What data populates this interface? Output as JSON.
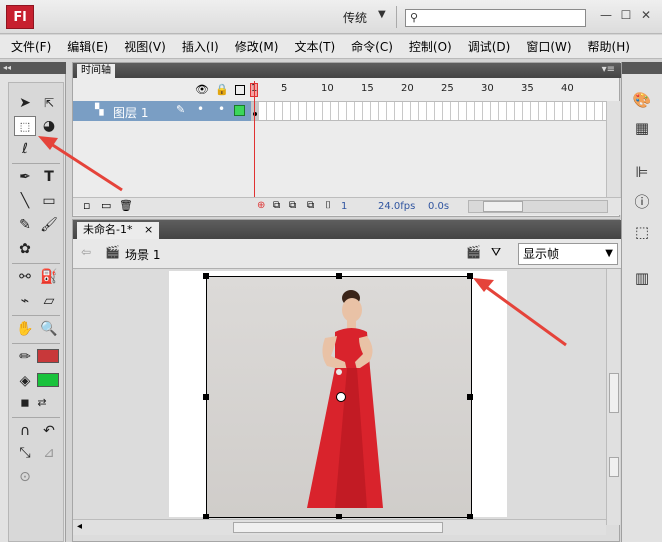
{
  "app": {
    "logo": "Fl",
    "workspace": "传统",
    "window_controls": [
      "—",
      "☐",
      "✕"
    ]
  },
  "menu": [
    "文件(F)",
    "编辑(E)",
    "视图(V)",
    "插入(I)",
    "修改(M)",
    "文本(T)",
    "命令(C)",
    "控制(O)",
    "调试(D)",
    "窗口(W)",
    "帮助(H)"
  ],
  "timeline": {
    "tab": "时间轴",
    "frame_numbers": [
      "1",
      "5",
      "10",
      "15",
      "20",
      "25",
      "30",
      "35",
      "40"
    ],
    "layer": "图层 1",
    "current_frame": "1",
    "fps": "24.0fps",
    "time": "0.0s"
  },
  "document": {
    "tab": "未命名-1*",
    "close": "×",
    "scene": "场景 1",
    "view": "显示帧"
  },
  "colors": {
    "stroke": "#c8383a",
    "fill": "#19c23c",
    "highlight_arrow": "#e5433a",
    "dress": "#d9232c"
  },
  "icons": [
    "selection-tool-icon",
    "subselection-tool-icon",
    "free-transform-tool-icon",
    "3d-rotation-tool-icon",
    "lasso-tool-icon",
    "pen-tool-icon",
    "text-tool-icon",
    "line-tool-icon",
    "rectangle-tool-icon",
    "pencil-tool-icon",
    "brush-tool-icon",
    "deco-tool-icon",
    "bone-tool-icon",
    "paint-bucket-icon",
    "eyedropper-icon",
    "eraser-icon",
    "hand-tool-icon",
    "zoom-tool-icon"
  ]
}
